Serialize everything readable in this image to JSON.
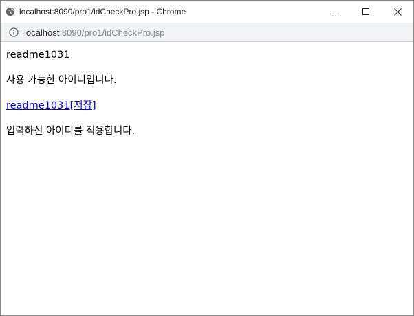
{
  "window": {
    "title": "localhost:8090/pro1/idCheckPro.jsp - Chrome",
    "controls": {
      "minimize_icon": "minimize-icon",
      "maximize_icon": "maximize-icon",
      "close_icon": "close-icon"
    }
  },
  "addressbar": {
    "url_host": "localhost",
    "url_rest": ":8090/pro1/idCheckPro.jsp",
    "info_icon": "info-icon"
  },
  "page": {
    "user_id": "readme1031",
    "available_message": "사용 가능한 아이디입니다.",
    "save_link_id": "readme1031",
    "save_link_label": "[저장]",
    "apply_message": "입력하신 아이디를 적용합니다."
  },
  "colors": {
    "link": "#0000ee",
    "addressbar_bg": "#f1f3f4"
  }
}
